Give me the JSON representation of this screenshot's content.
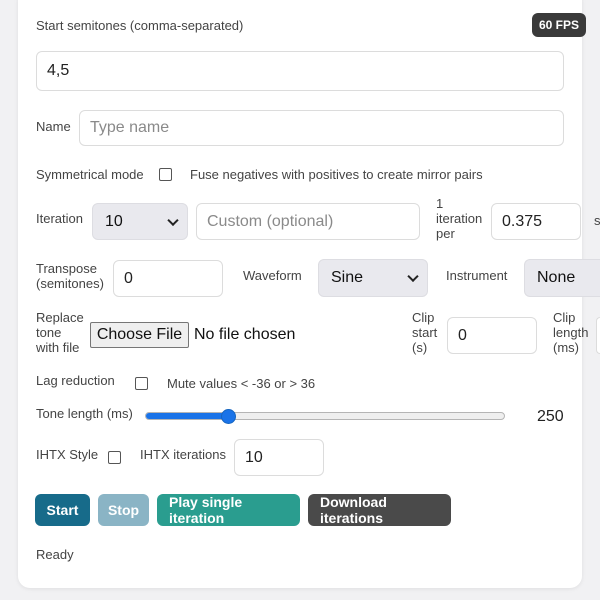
{
  "fps_badge": "60 FPS",
  "start_semitones": {
    "label": "Start semitones (comma-separated)",
    "value": "4,5"
  },
  "name": {
    "label": "Name",
    "placeholder": "Type name"
  },
  "symmetrical": {
    "label": "Symmetrical mode",
    "description": "Fuse negatives with positives to create mirror pairs",
    "checked": false
  },
  "iteration": {
    "label": "Iteration",
    "selected": "10",
    "custom_placeholder": "Custom (optional)"
  },
  "iteration_per": {
    "label_line1": "1",
    "label_line2": "iteration",
    "label_line3": "per",
    "value": "0.375",
    "unit_partial": "s"
  },
  "transpose": {
    "label_line1": "Transpose",
    "label_line2": "(semitones)",
    "value": "0"
  },
  "waveform": {
    "label": "Waveform",
    "selected": "Sine"
  },
  "instrument": {
    "label": "Instrument",
    "selected": "None"
  },
  "replace_tone": {
    "label_line1": "Replace",
    "label_line2": "tone",
    "label_line3": "with file",
    "button": "Choose File",
    "status": "No file chosen"
  },
  "clip_start": {
    "label_line1": "Clip",
    "label_line2": "start",
    "label_line3": "(s)",
    "value": "0"
  },
  "clip_length": {
    "label_line1": "Clip",
    "label_line2": "length",
    "label_line3": "(ms)"
  },
  "lag_reduction": {
    "label": "Lag reduction",
    "description": "Mute values < -36 or > 36",
    "checked": false
  },
  "tone_length": {
    "label": "Tone length (ms)",
    "value": "250",
    "fraction": 0.23
  },
  "ihtx": {
    "style_label": "IHTX Style",
    "checked": false,
    "iterations_label": "IHTX iterations",
    "iterations_value": "10"
  },
  "buttons": {
    "start": "Start",
    "stop": "Stop",
    "play_single": "Play single iteration",
    "download": "Download iterations"
  },
  "colors": {
    "start": "#176b8a",
    "stop": "#8ab4c5",
    "play": "#2a9d8f",
    "download": "#4a4a4a",
    "accent": "#1a73e8"
  },
  "status": "Ready"
}
